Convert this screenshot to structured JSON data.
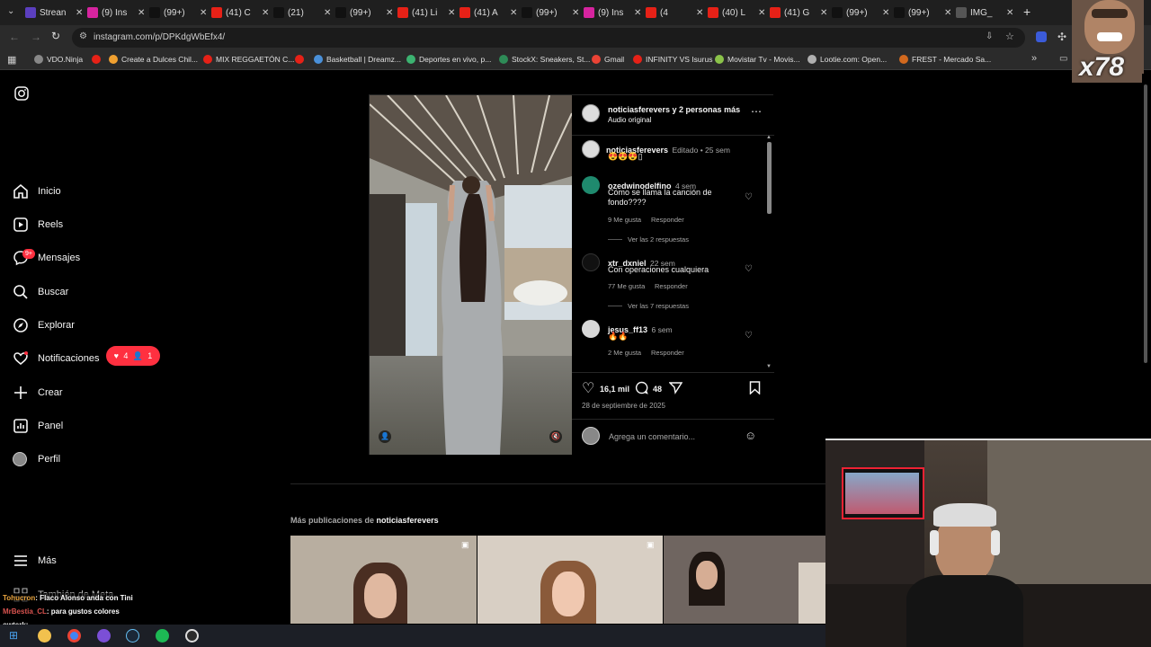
{
  "browser": {
    "tabs": [
      {
        "label": "Strean",
        "color": "#5b3fbf"
      },
      {
        "label": "(9) Ins",
        "color": "#d6249f"
      },
      {
        "label": "(99+)",
        "color": "#111111"
      },
      {
        "label": "(41) C",
        "color": "#e62117"
      },
      {
        "label": "(21) ",
        "color": "#111111"
      },
      {
        "label": "(99+)",
        "color": "#111111"
      },
      {
        "label": "(41) Li",
        "color": "#e62117"
      },
      {
        "label": "(41) A",
        "color": "#e62117"
      },
      {
        "label": "(99+)",
        "color": "#111111"
      },
      {
        "label": "(9) Ins",
        "color": "#d6249f"
      },
      {
        "label": "(4",
        "color": "#e62117"
      },
      {
        "label": "(40) L",
        "color": "#e62117"
      },
      {
        "label": "(41) G",
        "color": "#e62117"
      },
      {
        "label": "(99+)",
        "color": "#111111"
      },
      {
        "label": "(99+)",
        "color": "#111111"
      },
      {
        "label": "IMG_",
        "color": "#555555"
      }
    ],
    "url": "instagram.com/p/DPKdgWbEfx4/",
    "bookmarks": [
      {
        "label": "VDO.Ninja",
        "color": "#888888"
      },
      {
        "label": "",
        "color": "#e62117"
      },
      {
        "label": "Create a Dulces Chil...",
        "color": "#f0a030"
      },
      {
        "label": "MIX REGGAETÓN C...",
        "color": "#e62117"
      },
      {
        "label": "",
        "color": "#e62117"
      },
      {
        "label": "Basketball | Dreamz...",
        "color": "#4a90d9"
      },
      {
        "label": "Deportes en vivo, p...",
        "color": "#3cb371"
      },
      {
        "label": "StockX: Sneakers, St...",
        "color": "#2e8b57"
      },
      {
        "label": "Gmail",
        "color": "#ea4335"
      },
      {
        "label": "INFINITY VS Isurus",
        "color": "#e62117"
      },
      {
        "label": "Movistar Tv - Movis...",
        "color": "#8bc34a"
      },
      {
        "label": "Lootie.com: Open...",
        "color": "#b0b0b0"
      },
      {
        "label": "FREST - Mercado Sa...",
        "color": "#d2691e"
      }
    ]
  },
  "sidebar": {
    "items": [
      {
        "label": "Inicio",
        "icon": "home-icon"
      },
      {
        "label": "Reels",
        "icon": "reels-icon"
      },
      {
        "label": "Mensajes",
        "icon": "messenger-icon",
        "badge": "9+"
      },
      {
        "label": "Buscar",
        "icon": "search-icon"
      },
      {
        "label": "Explorar",
        "icon": "compass-icon"
      },
      {
        "label": "Notificaciones",
        "icon": "heart-icon"
      },
      {
        "label": "Crear",
        "icon": "plus-icon"
      },
      {
        "label": "Panel",
        "icon": "chart-icon"
      },
      {
        "label": "Perfil",
        "icon": "avatar"
      }
    ],
    "notif_badge": {
      "likes": "4",
      "followers": "1"
    },
    "more_label": "Más",
    "meta_label": "También de Meta"
  },
  "post": {
    "header_user": "noticiasferevers y 2 personas más",
    "header_sub": "Audio original",
    "caption_user": "noticiasferevers",
    "caption_meta": "Editado • 25 sem",
    "caption_text": "😍😍😍▯",
    "comments": [
      {
        "user": "ozedwinodelfino",
        "time": "4 sem",
        "text": "Cómo se llama la canción de fondo????",
        "likes": "9 Me gusta",
        "reply": "Responder",
        "replies": "Ver las 2 respuestas",
        "avatar_color": "#1f8a6e"
      },
      {
        "user": "xtr_dxniel",
        "time": "22 sem",
        "text": "Con operaciones cualquiera",
        "likes": "77 Me gusta",
        "reply": "Responder",
        "replies": "Ver las 7 respuestas",
        "avatar_color": "#111111"
      },
      {
        "user": "jesus_ff13",
        "time": "6 sem",
        "text": "🔥🔥",
        "likes": "2 Me gusta",
        "reply": "Responder",
        "replies": "",
        "avatar_color": "#d8d8d8"
      }
    ],
    "like_count": "16,1 mil",
    "comment_count": "48",
    "date": "28 de septiembre de 2025",
    "comment_placeholder": "Agrega un comentario..."
  },
  "more_posts": {
    "prefix": "Más publicaciones de",
    "user": "noticiasferevers"
  },
  "chat": [
    {
      "user": "Tohucron",
      "text": ": Flaco Alonso anda con Tini",
      "color": "#e8a33d"
    },
    {
      "user": "MrBestia_CL",
      "text": ": para gustos colores",
      "color": "#d9534f"
    },
    {
      "user": "owterk",
      "text": ":",
      "color": "#e8e8e8"
    }
  ],
  "overlay": {
    "multiplier": "x78"
  }
}
